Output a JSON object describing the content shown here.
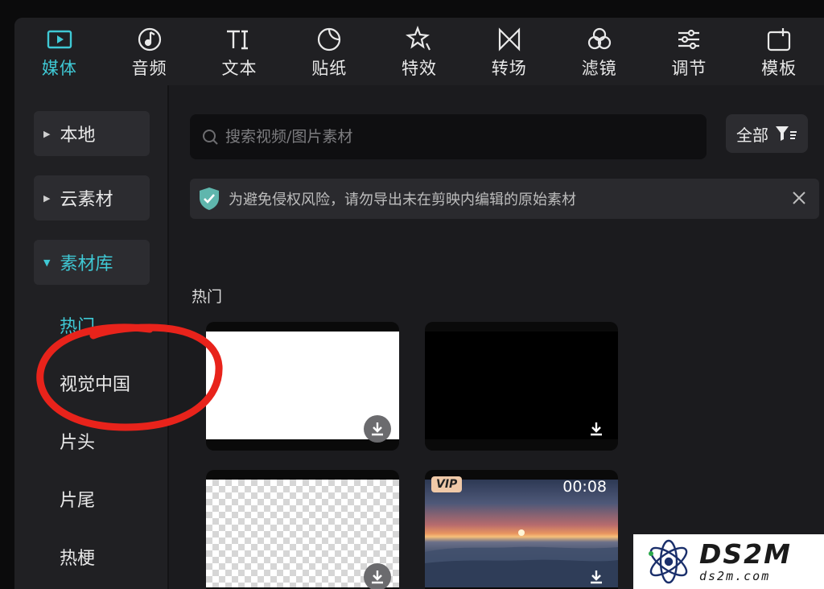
{
  "toolbar": {
    "tabs": [
      {
        "label": "媒体",
        "icon": "media-icon",
        "active": true
      },
      {
        "label": "音频",
        "icon": "audio-icon"
      },
      {
        "label": "文本",
        "icon": "text-icon"
      },
      {
        "label": "贴纸",
        "icon": "sticker-icon"
      },
      {
        "label": "特效",
        "icon": "effects-icon"
      },
      {
        "label": "转场",
        "icon": "transition-icon"
      },
      {
        "label": "滤镜",
        "icon": "filter-icon"
      },
      {
        "label": "调节",
        "icon": "adjust-icon"
      },
      {
        "label": "模板",
        "icon": "template-icon"
      }
    ]
  },
  "sidebar": {
    "items": [
      {
        "label": "本地",
        "state": "collapsed"
      },
      {
        "label": "云素材",
        "state": "collapsed"
      },
      {
        "label": "素材库",
        "state": "expanded"
      }
    ],
    "sub_items": [
      {
        "label": "热门",
        "active": true
      },
      {
        "label": "视觉中国"
      },
      {
        "label": "片头"
      },
      {
        "label": "片尾"
      },
      {
        "label": "热梗"
      }
    ]
  },
  "main": {
    "search": {
      "placeholder": "搜索视频/图片素材"
    },
    "filter": {
      "label": "全部"
    },
    "notice": {
      "text": "为避免侵权风险，请勿导出未在剪映内编辑的原始素材"
    },
    "section_title": "热门",
    "cards": [
      {
        "type": "white"
      },
      {
        "type": "black"
      },
      {
        "type": "transparent"
      },
      {
        "type": "sunset-video",
        "badge": "VIP",
        "duration": "00:08"
      }
    ]
  },
  "watermark": {
    "big": "DS2M",
    "small": "ds2m.com"
  },
  "colors": {
    "accent": "#3fc9d5",
    "annotation": "#e8231b",
    "background": "#1b1b1e",
    "panel": "#202023"
  }
}
